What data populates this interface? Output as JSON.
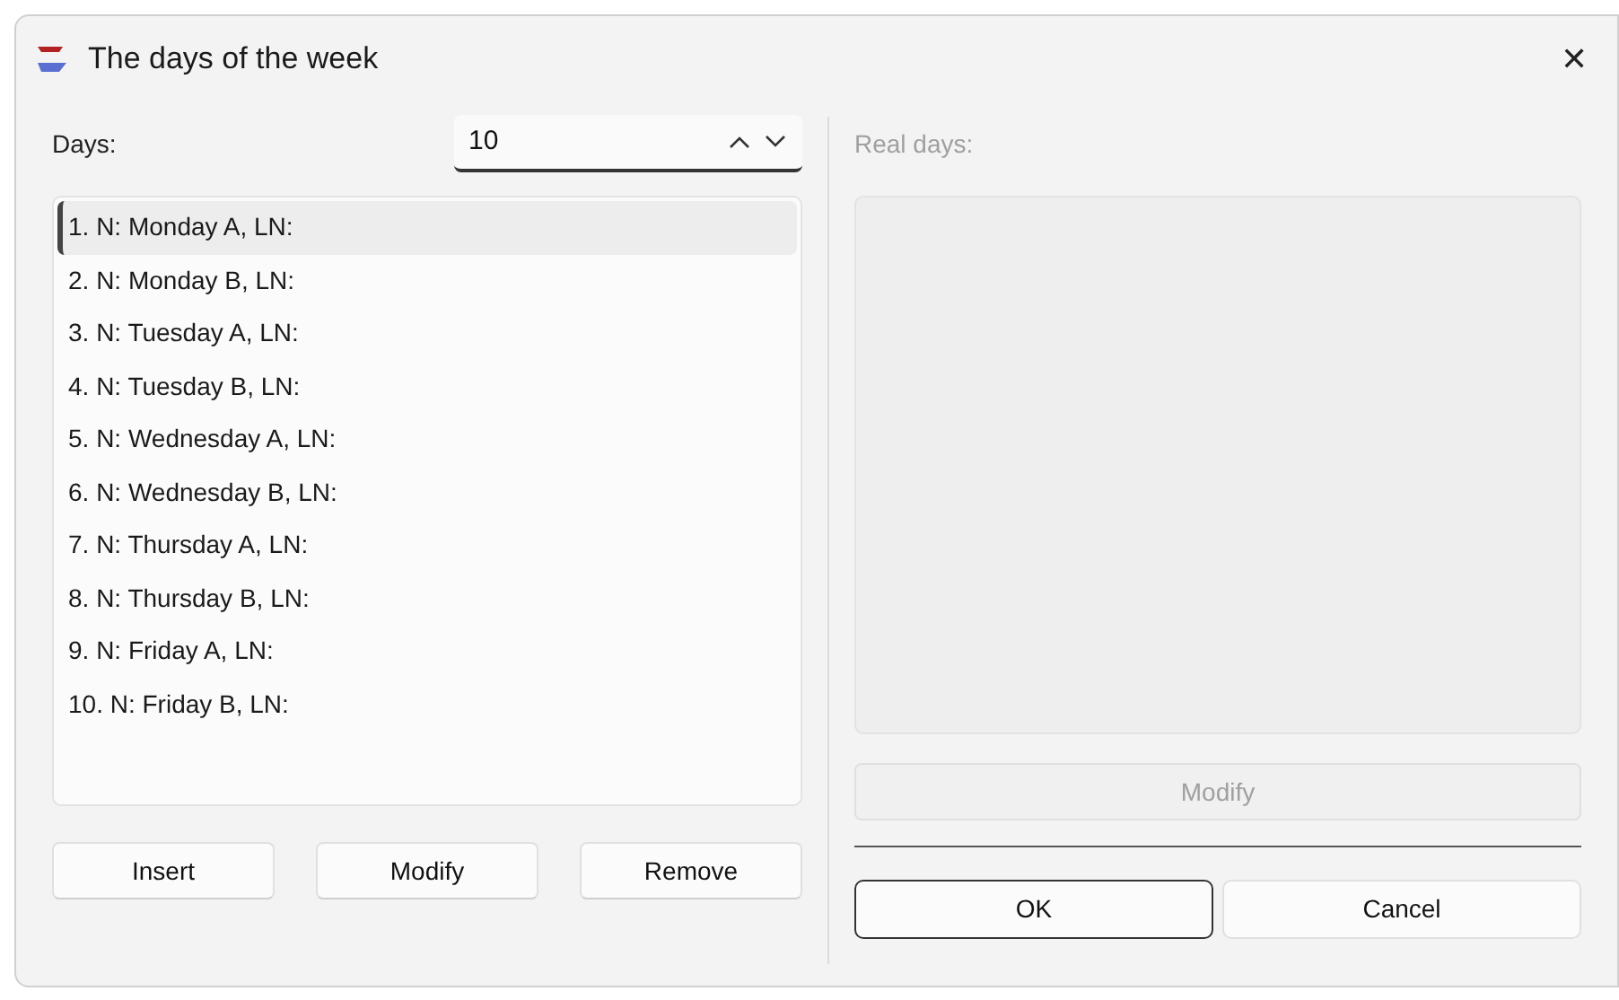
{
  "window": {
    "title": "The days of the week",
    "close": "✕"
  },
  "days": {
    "label": "Days:",
    "value": "10"
  },
  "list": [
    {
      "text": "1. N: Monday A, LN:",
      "selected": true
    },
    {
      "text": "2. N: Monday B, LN:",
      "selected": false
    },
    {
      "text": "3. N: Tuesday A, LN:",
      "selected": false
    },
    {
      "text": "4. N: Tuesday B, LN:",
      "selected": false
    },
    {
      "text": "5. N: Wednesday A, LN:",
      "selected": false
    },
    {
      "text": "6. N: Wednesday B, LN:",
      "selected": false
    },
    {
      "text": "7. N: Thursday A, LN:",
      "selected": false
    },
    {
      "text": "8. N: Thursday B, LN:",
      "selected": false
    },
    {
      "text": "9. N: Friday A, LN:",
      "selected": false
    },
    {
      "text": "10. N: Friday B, LN:",
      "selected": false
    }
  ],
  "left_buttons": [
    "Insert",
    "Modify",
    "Remove"
  ],
  "real_days": {
    "label": "Real days:",
    "disabled": true,
    "modify": "Modify"
  },
  "buttons": [
    {
      "label": "OK",
      "default": true
    },
    {
      "label": "Cancel",
      "default": false
    }
  ]
}
